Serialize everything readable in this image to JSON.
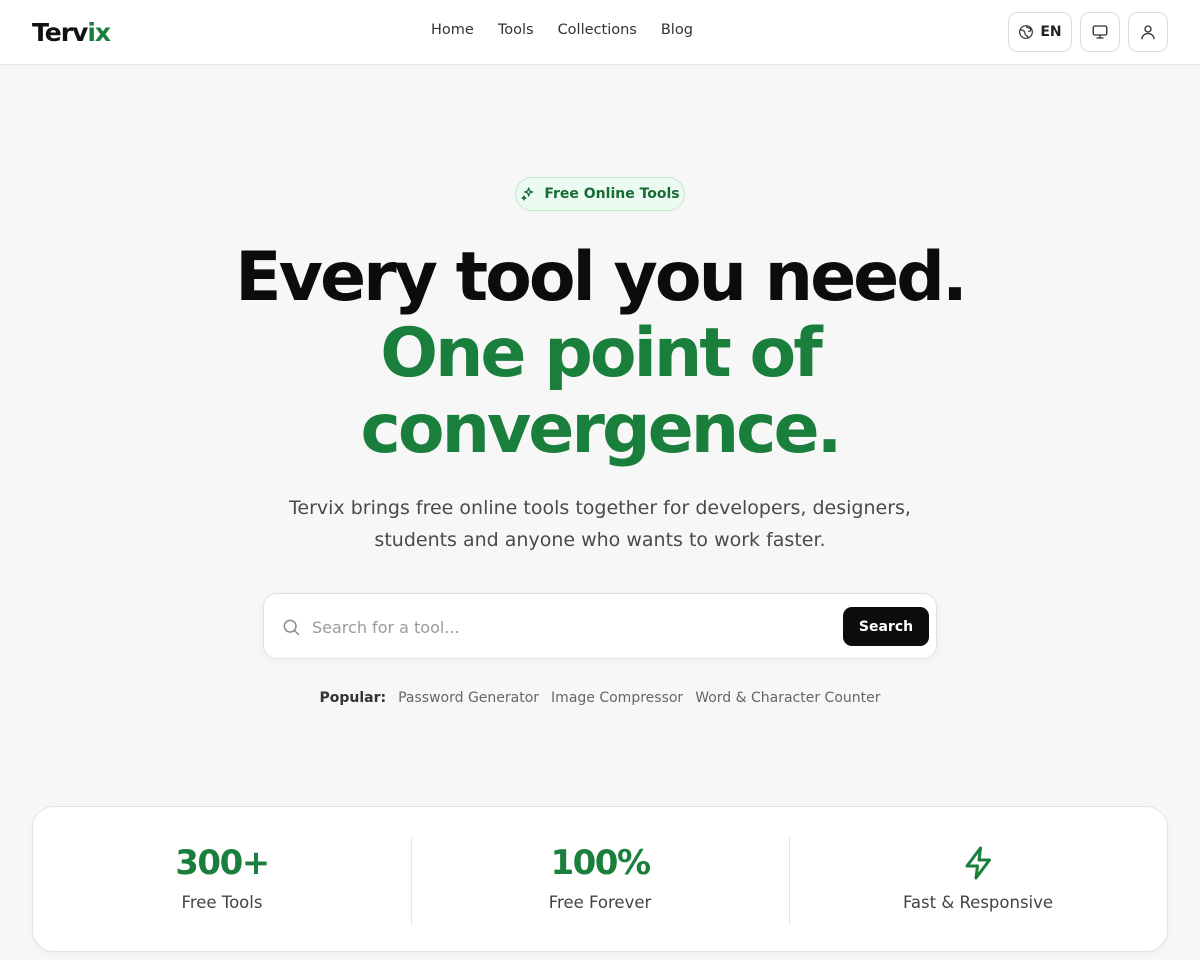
{
  "header": {
    "logo_main": "Terv",
    "logo_accent": "ix",
    "nav": [
      "Home",
      "Tools",
      "Collections",
      "Blog"
    ],
    "language": "EN"
  },
  "hero": {
    "badge": "Free Online Tools",
    "title_line1": "Every tool you need.",
    "title_line2a": "One point of",
    "title_line2b": "convergence.",
    "subtitle_line1": "Tervix brings free online tools together for developers, designers,",
    "subtitle_line2": "students and anyone who wants to work faster."
  },
  "search": {
    "placeholder": "Search for a tool...",
    "button_label": "Search"
  },
  "popular": {
    "label": "Popular:",
    "items": [
      "Password Generator",
      "Image Compressor",
      "Word & Character Counter"
    ]
  },
  "stats": [
    {
      "value": "300+",
      "label": "Free Tools"
    },
    {
      "value": "100%",
      "label": "Free Forever"
    },
    {
      "icon": "lightning-icon",
      "label": "Fast & Responsive"
    }
  ],
  "colors": {
    "accent": "#1a7f3c",
    "badge_bg": "#ecfbf1",
    "dark": "#0c0c0c"
  }
}
